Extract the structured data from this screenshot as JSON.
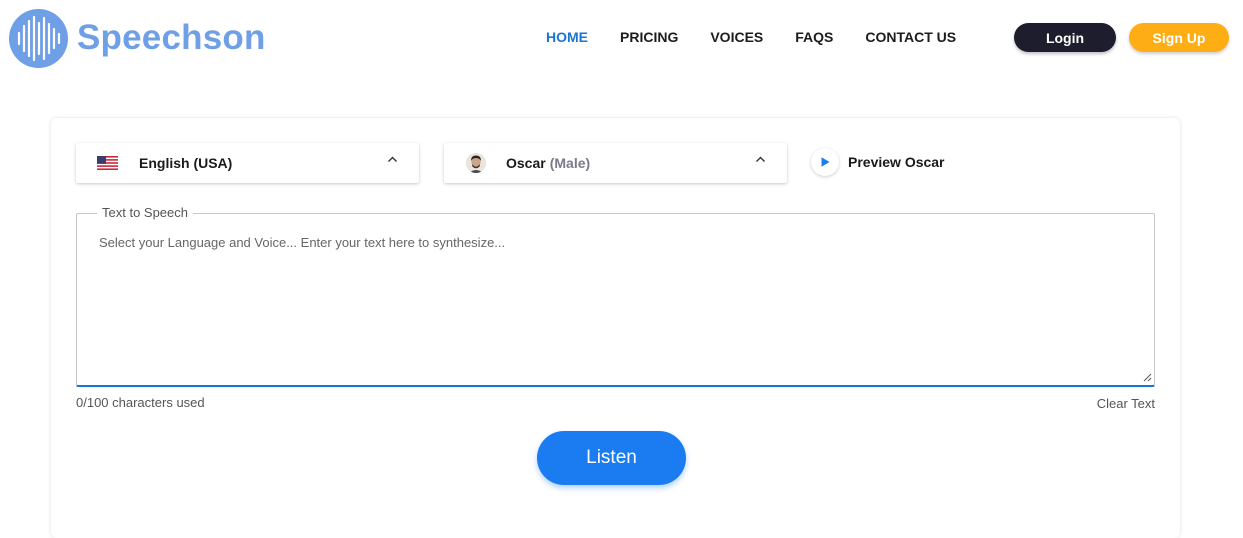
{
  "brand": {
    "name": "Speechson",
    "logo_icon": "soundwave-icon",
    "color": "#6f9fe6"
  },
  "nav": {
    "items": [
      {
        "label": "HOME",
        "active": true
      },
      {
        "label": "PRICING",
        "active": false
      },
      {
        "label": "VOICES",
        "active": false
      },
      {
        "label": "FAQS",
        "active": false
      },
      {
        "label": "CONTACT US",
        "active": false
      }
    ],
    "active_color": "#1976d2"
  },
  "auth": {
    "login_label": "Login",
    "signup_label": "Sign Up",
    "login_color": "#1d1d2e",
    "signup_color": "#ffad14"
  },
  "tts": {
    "language": {
      "value": "English (USA)",
      "icon": "us-flag-icon"
    },
    "voice": {
      "name": "Oscar",
      "gender": "(Male)",
      "icon": "avatar-icon"
    },
    "preview_label": "Preview Oscar",
    "field_label": "Text to Speech",
    "placeholder": "Select your Language and Voice... Enter your text here to synthesize...",
    "value": "",
    "char_count": "0/100 characters used",
    "clear_label": "Clear Text",
    "listen_label": "Listen",
    "accent_color": "#1a7cf0"
  }
}
